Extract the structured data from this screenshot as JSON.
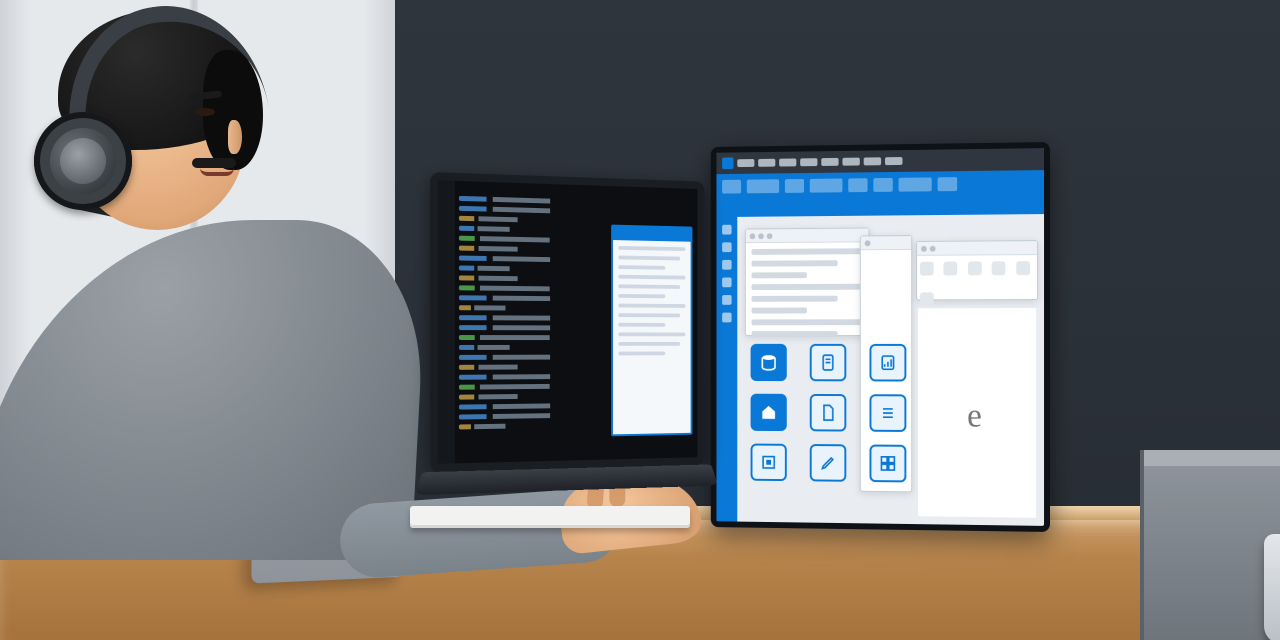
{
  "scene": {
    "description": "3D-rendered illustration of a man wearing headphones working at a desk with a laptop (code editor) and an external monitor showing a blue-accented application UI with an icon grid.",
    "accent_color": "#0a78d6",
    "scribble_glyph": "e"
  },
  "laptop": {
    "app": "code-editor",
    "side_panel_title": ""
  },
  "monitor": {
    "icons": [
      {
        "name": "database-icon",
        "label": ""
      },
      {
        "name": "document-icon",
        "label": ""
      },
      {
        "name": "report-icon",
        "label": ""
      },
      {
        "name": "home-icon",
        "label": ""
      },
      {
        "name": "page-icon",
        "label": ""
      },
      {
        "name": "list-icon",
        "label": ""
      },
      {
        "name": "module-icon",
        "label": ""
      },
      {
        "name": "edit-icon",
        "label": ""
      },
      {
        "name": "grid-icon",
        "label": ""
      }
    ]
  }
}
